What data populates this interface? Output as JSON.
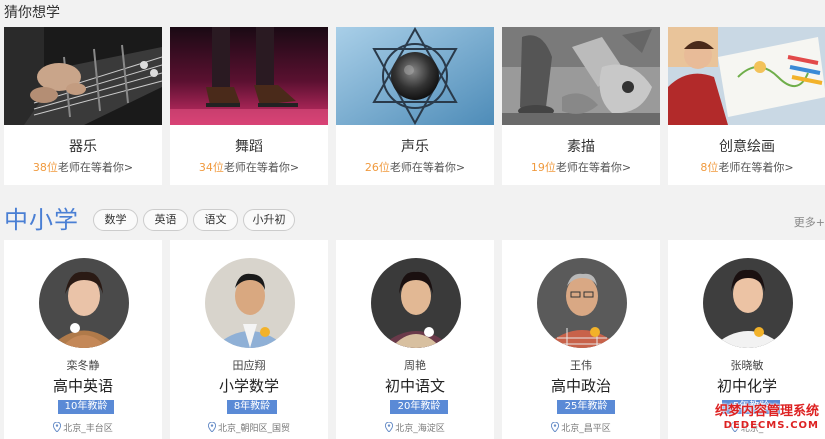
{
  "guess": {
    "title": "猜你想学",
    "categories": [
      {
        "name": "器乐",
        "count": "38位",
        "suffix": "老师在等着你>"
      },
      {
        "name": "舞蹈",
        "count": "34位",
        "suffix": "老师在等着你>"
      },
      {
        "name": "声乐",
        "count": "26位",
        "suffix": "老师在等着你>"
      },
      {
        "name": "素描",
        "count": "19位",
        "suffix": "老师在等着你>"
      },
      {
        "name": "创意绘画",
        "count": "8位",
        "suffix": "老师在等着你>"
      }
    ]
  },
  "k12": {
    "title": "中小学",
    "tags": [
      "数学",
      "英语",
      "语文",
      "小升初"
    ],
    "more": "更多+",
    "teachers": [
      {
        "name": "栾冬静",
        "subject": "高中英语",
        "years": "10年教龄",
        "location": "北京_丰台区"
      },
      {
        "name": "田应翔",
        "subject": "小学数学",
        "years": "8年教龄",
        "location": "北京_朝阳区_国贸"
      },
      {
        "name": "周艳",
        "subject": "初中语文",
        "years": "20年教龄",
        "location": "北京_海淀区"
      },
      {
        "name": "王伟",
        "subject": "高中政治",
        "years": "25年教龄",
        "location": "北京_昌平区"
      },
      {
        "name": "张晓敏",
        "subject": "初中化学",
        "years": "5年教龄",
        "location": "北京_"
      }
    ]
  },
  "watermark": {
    "line1": "织梦内容管理系统",
    "line2": "DEDECMS.COM"
  },
  "colors": {
    "accent": "#4a7fd4",
    "count": "#f09a3e",
    "badge": "#5a8ad6"
  }
}
